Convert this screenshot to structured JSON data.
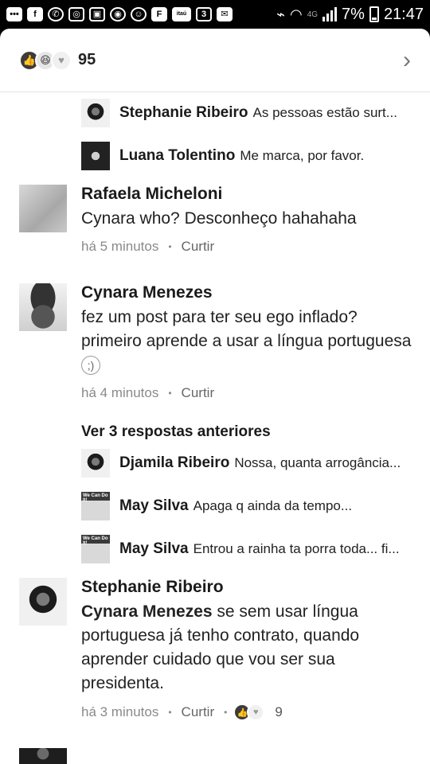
{
  "status_bar": {
    "left_icons": [
      "more-icon",
      "facebook-icon",
      "whatsapp-icon",
      "instagram-icon",
      "photo-icon",
      "camera-icon",
      "emoji-icon",
      "flipboard-icon",
      "itau-icon",
      "app-icon",
      "mail-icon"
    ],
    "itau_label": "itaú",
    "network": "4G",
    "battery": "7%",
    "time": "21:47"
  },
  "reactions_bar": {
    "count": "95",
    "icons": [
      "like-icon",
      "haha-icon",
      "love-icon"
    ]
  },
  "top_replies": [
    {
      "name": "Stephanie Ribeiro",
      "text": "As pessoas estão surt..."
    },
    {
      "name": "Luana Tolentino",
      "text": "Me marca, por favor."
    }
  ],
  "comments": [
    {
      "name": "Rafaela Micheloni",
      "text": "Cynara who? Desconheço hahahaha",
      "time": "há 5 minutos",
      "like_label": "Curtir"
    },
    {
      "name": "Cynara Menezes",
      "text": "fez um post para ter seu ego inflado? primeiro aprende a usar a língua portuguesa",
      "emoji": "😉",
      "time": "há 4 minutos",
      "like_label": "Curtir"
    },
    {
      "name": "Stephanie Ribeiro",
      "mention": "Cynara Menezes",
      "text": " se sem usar língua portuguesa já tenho contrato, quando aprender cuidado que vou ser sua presidenta.",
      "time": "há 3 minutos",
      "like_label": "Curtir",
      "reaction_count": "9"
    }
  ],
  "more_replies_label": "Ver 3 respostas anteriores",
  "nested_replies": [
    {
      "name": "Djamila Ribeiro",
      "text": "Nossa, quanta arrogância..."
    },
    {
      "name": "May Silva",
      "text": "Apaga q ainda da tempo..."
    },
    {
      "name": "May Silva",
      "text": "Entrou a rainha ta porra toda... fi..."
    }
  ],
  "avatar_poster_label": "We Can Do It!"
}
